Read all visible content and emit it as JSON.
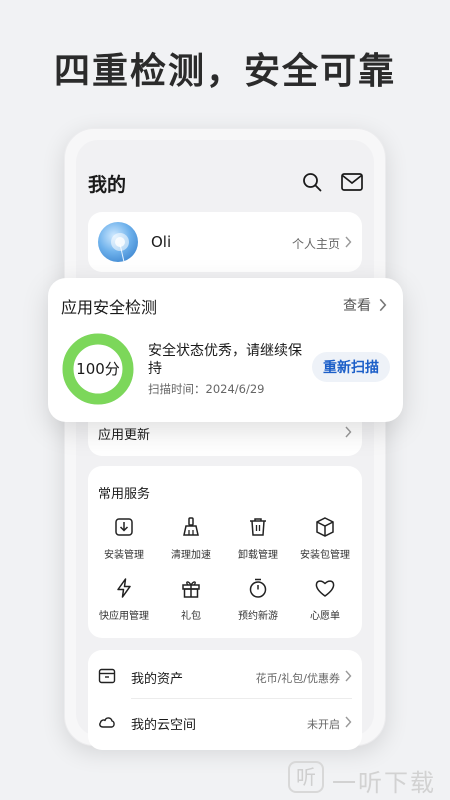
{
  "headline": "四重检测，安全可靠",
  "page": {
    "title": "我的",
    "icons": {
      "search": "search-icon",
      "mail": "mail-icon"
    }
  },
  "profile": {
    "name": "Oli",
    "homepage_link": "个人主页"
  },
  "security_check": {
    "title": "应用安全检测",
    "view_label": "查看",
    "score": "100分",
    "score_progress": 1.0,
    "status": "安全状态优秀，请继续保持",
    "scan_time": "扫描时间：2024/6/29",
    "rescan_label": "重新扫描",
    "ring_color": "#7cd75a"
  },
  "app_update": {
    "label": "应用更新"
  },
  "services": {
    "title": "常用服务",
    "items": [
      {
        "label": "安装管理",
        "icon": "install-icon"
      },
      {
        "label": "清理加速",
        "icon": "broom-icon"
      },
      {
        "label": "卸载管理",
        "icon": "trash-icon"
      },
      {
        "label": "安装包管理",
        "icon": "package-icon"
      },
      {
        "label": "快应用管理",
        "icon": "flash-icon"
      },
      {
        "label": "礼包",
        "icon": "gift-icon"
      },
      {
        "label": "预约新游",
        "icon": "timer-icon"
      },
      {
        "label": "心愿单",
        "icon": "heart-icon"
      }
    ]
  },
  "assets": {
    "rows": [
      {
        "label": "我的资产",
        "value": "花币/礼包/优惠券",
        "icon": "wallet-icon"
      },
      {
        "label": "我的云空间",
        "value": "未开启",
        "icon": "cloud-icon"
      }
    ]
  },
  "watermark": {
    "logo": "听",
    "text": "一听下载"
  },
  "colors": {
    "accent": "#1c5fc8",
    "ring": "#7cd75a",
    "background": "#f1f2f4"
  }
}
